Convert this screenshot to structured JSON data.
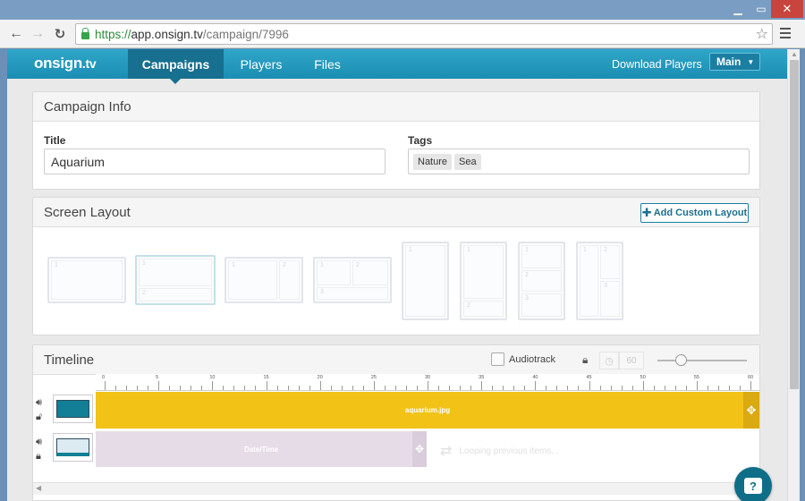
{
  "window": {
    "minimize_icon": "minimize-icon",
    "maximize_icon": "maximize-icon",
    "close_icon": "close-icon"
  },
  "browser": {
    "url_scheme": "https://",
    "url_host": "app.onsign.tv",
    "url_path": "/campaign/7996"
  },
  "app": {
    "logo": "onsign",
    "logo_suffix": ".tv",
    "nav": {
      "campaigns": "Campaigns",
      "players": "Players",
      "files": "Files"
    },
    "download_players": "Download Players",
    "main_menu": "Main",
    "accent": "#1b8db3"
  },
  "campaign_info": {
    "heading": "Campaign Info",
    "title_label": "Title",
    "title_value": "Aquarium",
    "tags_label": "Tags",
    "tags": [
      "Nature",
      "Sea"
    ]
  },
  "screen_layout": {
    "heading": "Screen Layout",
    "add_button": "Add Custom Layout",
    "layouts": [
      {
        "cells": [
          "1"
        ]
      },
      {
        "cells": [
          "1",
          "2"
        ],
        "selected": true
      },
      {
        "cells": [
          "1",
          "2"
        ]
      },
      {
        "cells": [
          "1",
          "2",
          "3"
        ]
      },
      {
        "cells": [
          "1"
        ]
      },
      {
        "cells": [
          "1",
          "2"
        ]
      },
      {
        "cells": [
          "1",
          "2",
          "3"
        ]
      },
      {
        "cells": [
          "1",
          "2",
          "3"
        ]
      }
    ]
  },
  "timeline": {
    "heading": "Timeline",
    "audiotrack_label": "Audiotrack",
    "duration": "60",
    "ruler_labels": [
      "0",
      "5",
      "10",
      "15",
      "20",
      "25",
      "30",
      "35",
      "40",
      "45",
      "50",
      "55",
      "60"
    ],
    "tracks": [
      {
        "item": "aquarium.jpg",
        "color": "#f2c217"
      },
      {
        "item": "Date/Time",
        "loop_text": "Looping previous items...",
        "color": "#e6dce8"
      }
    ]
  }
}
